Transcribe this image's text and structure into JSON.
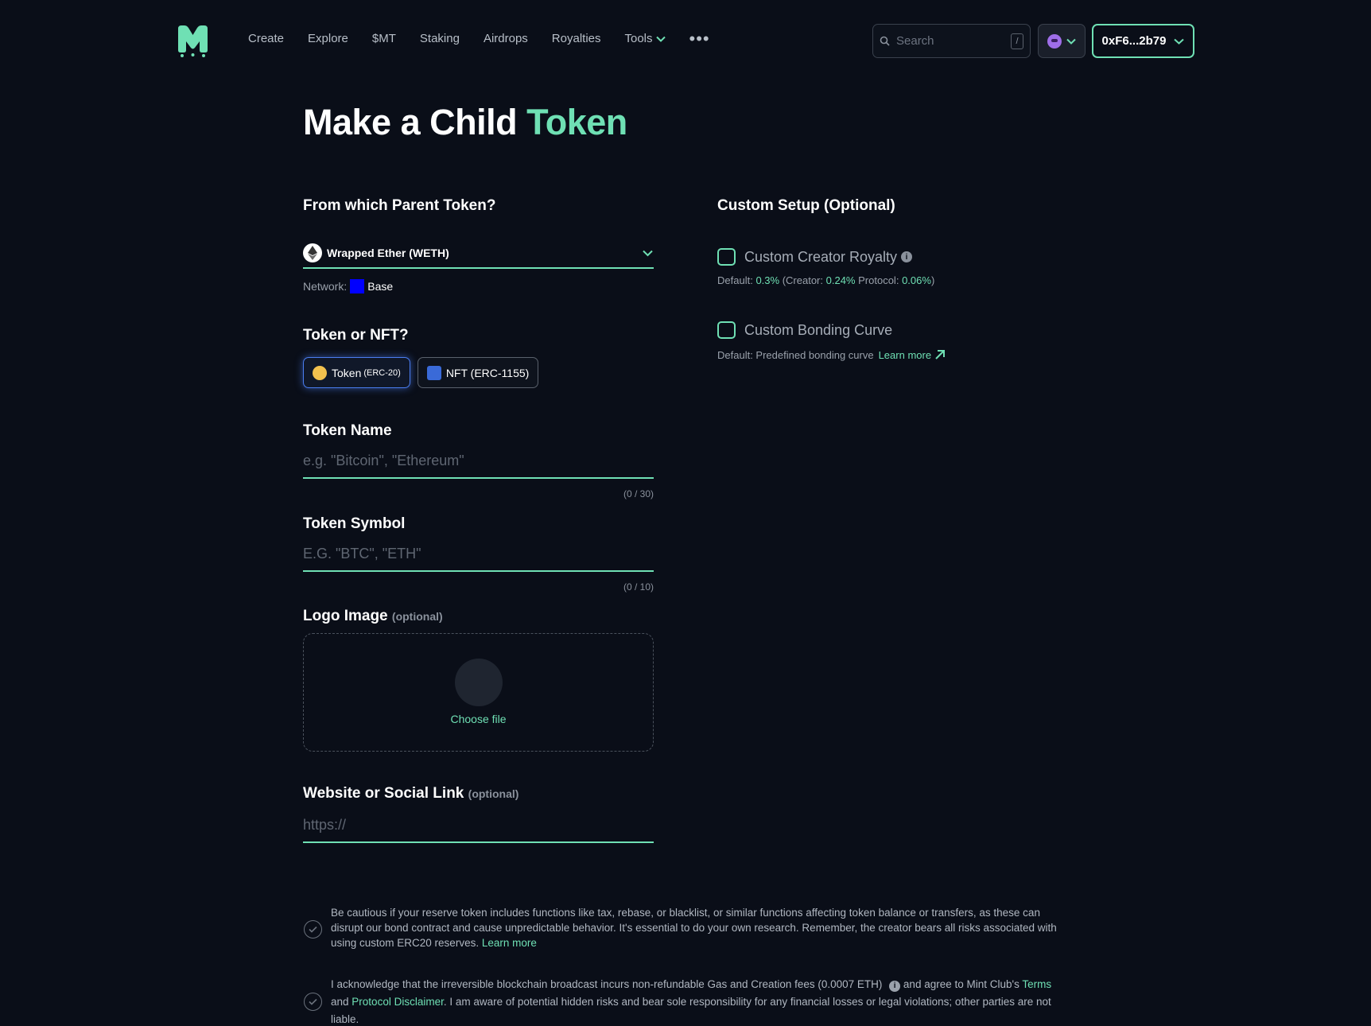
{
  "header": {
    "nav": [
      "Create",
      "Explore",
      "$MT",
      "Staking",
      "Airdrops",
      "Royalties",
      "Tools"
    ],
    "more": "•••",
    "search_placeholder": "Search",
    "search_shortcut": "/",
    "wallet": "0xF6...2b79"
  },
  "page": {
    "title_main": "Make a Child",
    "title_accent": "Token"
  },
  "parent": {
    "label": "From which Parent Token?",
    "selected": "Wrapped Ether (WETH)",
    "network_label": "Network:",
    "network": "Base"
  },
  "type": {
    "label": "Token or NFT?",
    "token": "Token",
    "token_std": "(ERC-20)",
    "nft": "NFT (ERC-1155)"
  },
  "token_name": {
    "label": "Token Name",
    "placeholder": "e.g. \"Bitcoin\", \"Ethereum\"",
    "counter": "(0 / 30)"
  },
  "token_symbol": {
    "label": "Token Symbol",
    "placeholder": "E.G. \"BTC\", \"ETH\"",
    "counter": "(0 / 10)"
  },
  "logo": {
    "label": "Logo Image",
    "optional": "(optional)",
    "choose": "Choose file"
  },
  "website": {
    "label": "Website or Social Link",
    "optional": "(optional)",
    "placeholder": "https://"
  },
  "custom": {
    "label": "Custom Setup (Optional)",
    "royalty_label": "Custom Creator Royalty",
    "royalty_default_prefix": "Default:",
    "royalty_total": "0.3%",
    "royalty_creator_prefix": "(Creator:",
    "royalty_creator": "0.24%",
    "royalty_protocol_prefix": "Protocol:",
    "royalty_protocol": "0.06%",
    "royalty_close": ")",
    "curve_label": "Custom Bonding Curve",
    "curve_default": "Default: Predefined bonding curve",
    "learn_more": "Learn more"
  },
  "disclaimers": {
    "caution_text": "Be cautious if your reserve token includes functions like tax, rebase, or blacklist, or similar functions affecting token balance or transfers, as these can disrupt our bond contract and cause unpredictable behavior. It's essential to do your own research. Remember, the creator bears all risks associated with using custom ERC20 reserves.",
    "caution_link": "Learn more",
    "ack_part1": "I acknowledge that the irreversible blockchain broadcast incurs non-refundable Gas and Creation fees (0.0007 ETH)",
    "ack_part2": "and agree to Mint Club's",
    "terms": "Terms",
    "and": "and",
    "protocol_disclaimer": "Protocol Disclaimer",
    "ack_part3": ". I am aware of potential hidden risks and bear sole responsibility for any financial losses or legal violations; other parties are not liable."
  },
  "colors": {
    "accent": "#6fe0b4",
    "background": "#0a0e18",
    "base_network": "#0000ff",
    "token_coin": "#f2c14e",
    "nft_square": "#3a6ad8"
  }
}
